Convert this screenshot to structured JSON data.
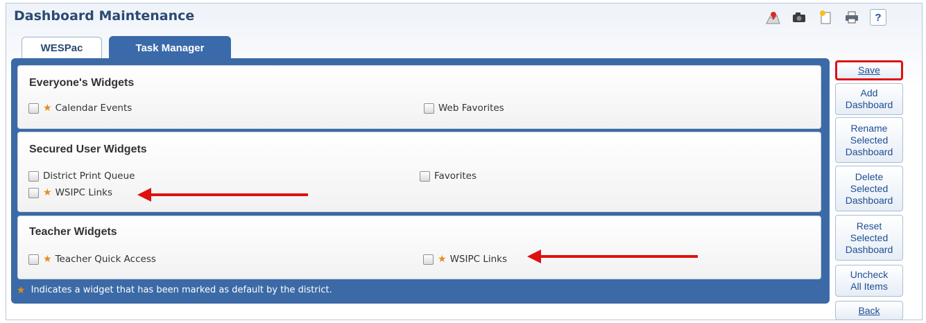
{
  "header": {
    "title": "Dashboard Maintenance",
    "toolbar_icons": [
      "map-marker-icon",
      "camera-icon",
      "new-document-icon",
      "print-icon",
      "help-icon"
    ],
    "help_label": "?"
  },
  "tabs": [
    {
      "label": "WESPac",
      "active": false
    },
    {
      "label": "Task Manager",
      "active": true
    }
  ],
  "sections": [
    {
      "title": "Everyone's Widgets",
      "items": [
        {
          "label": "Calendar Events",
          "default": true,
          "checked": false
        },
        {
          "label": "Web Favorites",
          "default": false,
          "checked": false
        }
      ]
    },
    {
      "title": "Secured User Widgets",
      "items": [
        {
          "label": "District Print Queue",
          "default": false,
          "checked": false
        },
        {
          "label": "Favorites",
          "default": false,
          "checked": false
        },
        {
          "label": "WSIPC Links",
          "default": true,
          "checked": false
        }
      ]
    },
    {
      "title": "Teacher Widgets",
      "items": [
        {
          "label": "Teacher Quick Access",
          "default": true,
          "checked": false
        },
        {
          "label": "WSIPC Links",
          "default": true,
          "checked": false
        }
      ]
    }
  ],
  "footnote": "Indicates a widget that has been marked as default by the district.",
  "side_buttons": {
    "save": "Save",
    "add": "Add\nDashboard",
    "rename": "Rename\nSelected\nDashboard",
    "delete": "Delete\nSelected\nDashboard",
    "reset": "Reset\nSelected\nDashboard",
    "uncheck": "Uncheck\nAll Items",
    "back": "Back"
  },
  "colors": {
    "panel": "#3b6aa6",
    "accent": "#1e4e93",
    "star": "#e88a1a",
    "annotation": "#e01010"
  }
}
